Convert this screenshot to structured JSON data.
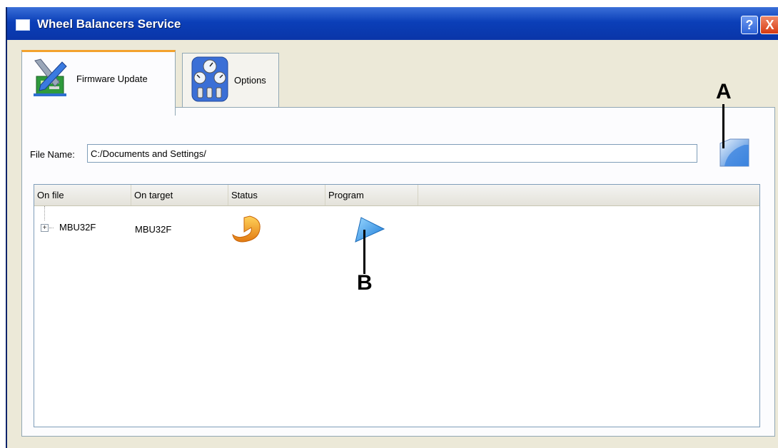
{
  "window": {
    "title": "Wheel Balancers Service",
    "help_label": "?",
    "close_label": "X"
  },
  "tabs": [
    {
      "label": "Firmware Update",
      "icon": "firmware-update-icon",
      "selected": true
    },
    {
      "label": "Options",
      "icon": "gauges-options-icon",
      "selected": false
    }
  ],
  "file": {
    "label": "File Name:",
    "value": "C:/Documents and Settings/",
    "browse_icon": "folder-browse-icon"
  },
  "list": {
    "columns": [
      "On file",
      "On target",
      "Status",
      "Program"
    ],
    "rows": [
      {
        "expander": "+",
        "on_file": "MBU32F",
        "on_target": "MBU32F",
        "status_icon": "orange-update-arrow-icon",
        "program_icon": "blue-play-icon"
      }
    ]
  },
  "callouts": {
    "a": "A",
    "b": "B"
  },
  "colors": {
    "titlebar": "#0b3fb8",
    "window_bg": "#ece9d8",
    "tab_highlight": "#f3a22d",
    "status_orange": "#f5a623",
    "program_blue": "#3da9f0"
  }
}
